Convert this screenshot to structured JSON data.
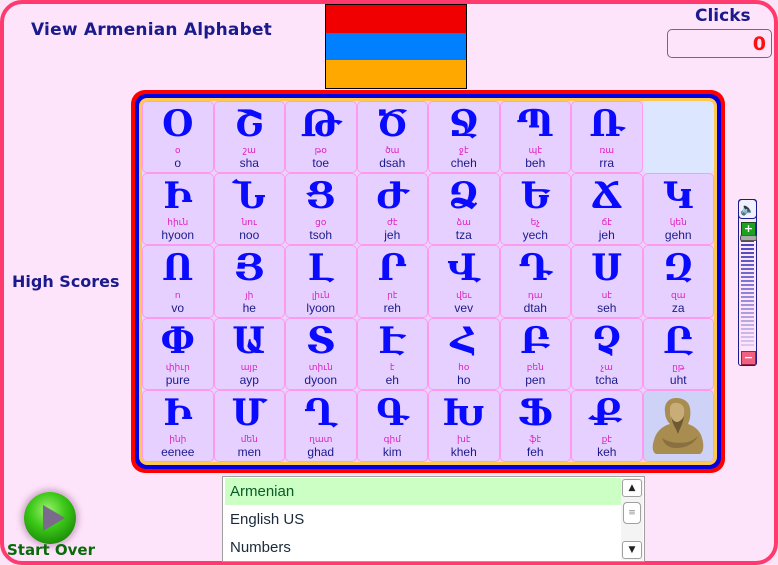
{
  "header": {
    "title": "View Armenian Alphabet",
    "clicks_label": "Clicks",
    "clicks_value": "0",
    "high_scores_label": "High Scores",
    "flag_colors": [
      "#f00000",
      "#0080ff",
      "#ffa800"
    ]
  },
  "board": {
    "cells": [
      {
        "letter": "Օ",
        "armenian": "օ",
        "latin": "o"
      },
      {
        "letter": "Շ",
        "armenian": "շա",
        "latin": "sha"
      },
      {
        "letter": "Թ",
        "armenian": "թօ",
        "latin": "toe"
      },
      {
        "letter": "Ծ",
        "armenian": "ծա",
        "latin": "dsah"
      },
      {
        "letter": "Ջ",
        "armenian": "ջէ",
        "latin": "cheh"
      },
      {
        "letter": "Պ",
        "armenian": "պէ",
        "latin": "beh"
      },
      {
        "letter": "Ռ",
        "armenian": "ռա",
        "latin": "rra"
      },
      {
        "empty": true
      },
      {
        "letter": "Ի",
        "armenian": "հիւն",
        "latin": "hyoon"
      },
      {
        "letter": "Ն",
        "armenian": "նու",
        "latin": "noo"
      },
      {
        "letter": "Ց",
        "armenian": "ցօ",
        "latin": "tsoh"
      },
      {
        "letter": "Ժ",
        "armenian": "ժէ",
        "latin": "jeh"
      },
      {
        "letter": "Ձ",
        "armenian": "ձա",
        "latin": "tza"
      },
      {
        "letter": "Ե",
        "armenian": "եչ",
        "latin": "yech"
      },
      {
        "letter": "Ճ",
        "armenian": "ճէ",
        "latin": "jeh"
      },
      {
        "letter": "Կ",
        "armenian": "կեն",
        "latin": "gehn"
      },
      {
        "letter": "Ո",
        "armenian": "ո",
        "latin": "vo"
      },
      {
        "letter": "Յ",
        "armenian": "յի",
        "latin": "he"
      },
      {
        "letter": "Լ",
        "armenian": "լիւն",
        "latin": "lyoon"
      },
      {
        "letter": "Ր",
        "armenian": "րէ",
        "latin": "reh"
      },
      {
        "letter": "Վ",
        "armenian": "վեւ",
        "latin": "vev"
      },
      {
        "letter": "Դ",
        "armenian": "դա",
        "latin": "dtah"
      },
      {
        "letter": "Ս",
        "armenian": "սէ",
        "latin": "seh"
      },
      {
        "letter": "Զ",
        "armenian": "զա",
        "latin": "za"
      },
      {
        "letter": "Փ",
        "armenian": "փիւր",
        "latin": "pure"
      },
      {
        "letter": "Ա",
        "armenian": "այբ",
        "latin": "ayp"
      },
      {
        "letter": "Տ",
        "armenian": "տիւն",
        "latin": "dyoon"
      },
      {
        "letter": "Է",
        "armenian": "է",
        "latin": "eh"
      },
      {
        "letter": "Հ",
        "armenian": "հօ",
        "latin": "ho"
      },
      {
        "letter": "Բ",
        "armenian": "բեն",
        "latin": "pen"
      },
      {
        "letter": "Չ",
        "armenian": "չա",
        "latin": "tcha"
      },
      {
        "letter": "Ը",
        "armenian": "ըթ",
        "latin": "uht"
      },
      {
        "letter": "Ի",
        "armenian": "ինի",
        "latin": "eenee"
      },
      {
        "letter": "Մ",
        "armenian": "մեն",
        "latin": "men"
      },
      {
        "letter": "Ղ",
        "armenian": "ղատ",
        "latin": "ghad"
      },
      {
        "letter": "Գ",
        "armenian": "գիմ",
        "latin": "kim"
      },
      {
        "letter": "Խ",
        "armenian": "խէ",
        "latin": "kheh"
      },
      {
        "letter": "Ֆ",
        "armenian": "ֆէ",
        "latin": "feh"
      },
      {
        "letter": "Ք",
        "armenian": "քէ",
        "latin": "keh"
      },
      {
        "portrait": true
      }
    ]
  },
  "volume": {
    "plus": "+",
    "minus": "−",
    "speaker_icon": "speaker-icon"
  },
  "start_over": {
    "label": "Start Over"
  },
  "language_list": {
    "items": [
      "Armenian",
      "English US",
      "Numbers"
    ],
    "selected": "Armenian"
  },
  "scrollbar": {
    "up": "▲",
    "down": "▼",
    "thumb": "≡"
  }
}
